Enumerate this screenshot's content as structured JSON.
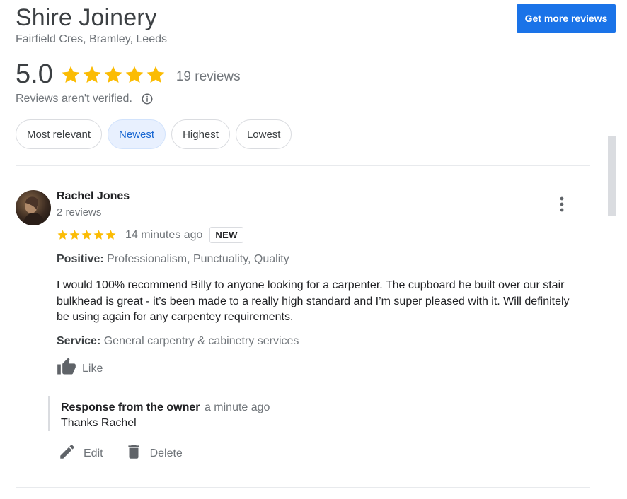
{
  "business": {
    "name": "Shire Joinery",
    "address": "Fairfield Cres, Bramley, Leeds"
  },
  "cta": {
    "label": "Get more reviews",
    "color": "#1a73e8"
  },
  "summary": {
    "rating": "5.0",
    "stars": 5,
    "review_count": "19 reviews",
    "unverified_note": "Reviews aren't verified.",
    "info_icon": "info-icon"
  },
  "filters": [
    {
      "label": "Most relevant",
      "active": false
    },
    {
      "label": "Newest",
      "active": true
    },
    {
      "label": "Highest",
      "active": false
    },
    {
      "label": "Lowest",
      "active": false
    }
  ],
  "review": {
    "author": "Rachel Jones",
    "author_meta": "2 reviews",
    "stars": 5,
    "time": "14 minutes ago",
    "badge": "NEW",
    "positive_label": "Positive:",
    "positive_value": "Professionalism, Punctuality, Quality",
    "text": "I would 100% recommend Billy to anyone looking for a carpenter. The cupboard he built over our stair bulkhead is great - it’s been made to a really high standard and I’m super pleased with it. Will definitely be using again for any carpentey requirements.",
    "service_label": "Service:",
    "service_value": "General carpentry & cabinetry services",
    "like_label": "Like",
    "owner_response": {
      "label": "Response from the owner",
      "time": "a minute ago",
      "text": "Thanks Rachel"
    },
    "actions": {
      "edit_label": "Edit",
      "delete_label": "Delete"
    }
  },
  "colors": {
    "star": "#fbbc04",
    "accent": "#1a73e8",
    "chip_active_bg": "#e8f0fe",
    "chip_active_text": "#1967d2",
    "muted_text": "#70757a"
  }
}
